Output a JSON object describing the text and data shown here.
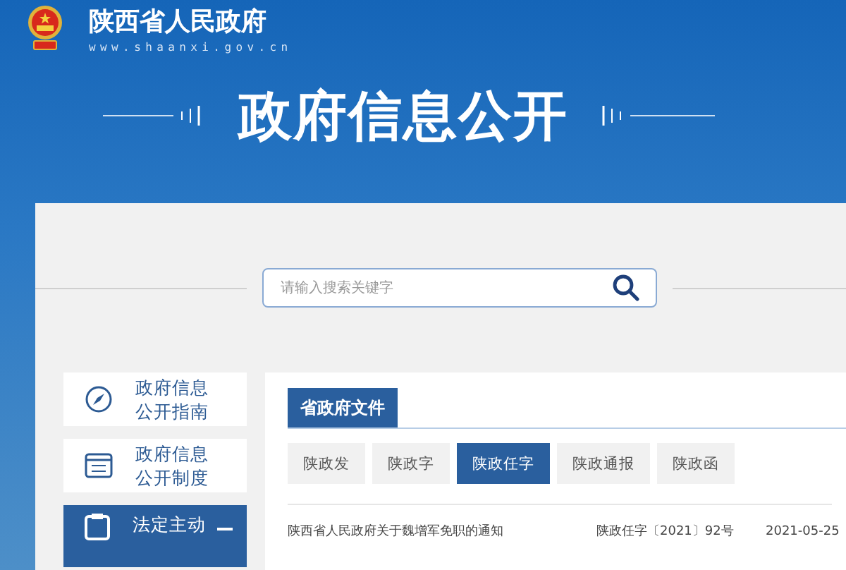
{
  "header": {
    "site_title": "陕西省人民政府",
    "site_url": "www.shaanxi.gov.cn"
  },
  "hero": {
    "title": "政府信息公开"
  },
  "search": {
    "placeholder": "请输入搜索关键字"
  },
  "sidebar": {
    "items": [
      {
        "lines": [
          "政府信息",
          "公开指南"
        ],
        "selected": false
      },
      {
        "lines": [
          "政府信息",
          "公开制度"
        ],
        "selected": false
      },
      {
        "lines": [
          "法定主动"
        ],
        "selected": true
      }
    ]
  },
  "content": {
    "tabs": [
      {
        "label": "省政府文件",
        "selected": true
      }
    ],
    "filters": [
      {
        "label": "陕政发",
        "selected": false
      },
      {
        "label": "陕政字",
        "selected": false
      },
      {
        "label": "陕政任字",
        "selected": true
      },
      {
        "label": "陕政通报",
        "selected": false
      },
      {
        "label": "陕政函",
        "selected": false
      }
    ],
    "rows": [
      {
        "title": "陕西省人民政府关于魏增军免职的通知",
        "doc_number": "陕政任字〔2021〕92号",
        "date": "2021-05-25"
      }
    ]
  }
}
